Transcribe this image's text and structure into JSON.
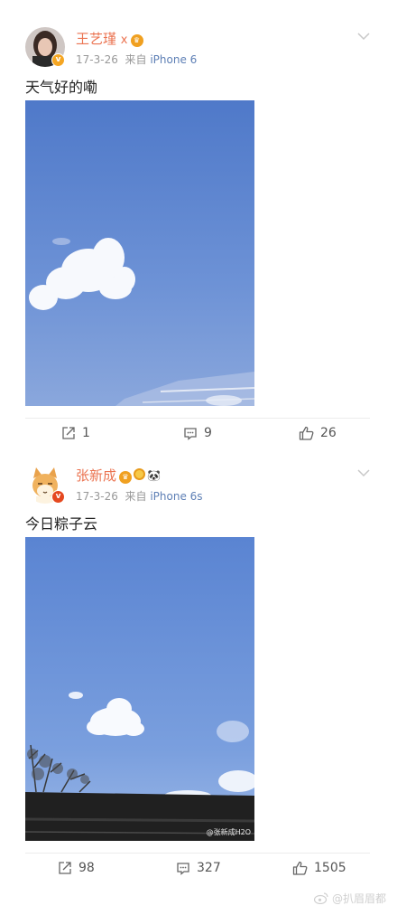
{
  "posts": [
    {
      "username": "王艺瑾",
      "user_suffix": "x",
      "date": "17-3-26",
      "source_prefix": "来自",
      "device": "iPhone 6",
      "text": "天气好的嘞",
      "actions": {
        "repost": "1",
        "comment": "9",
        "like": "26"
      }
    },
    {
      "username": "张新成",
      "date": "17-3-26",
      "source_prefix": "来自",
      "device": "iPhone 6s",
      "text": "今日粽子云",
      "photo_watermark": "@张新成H2O",
      "actions": {
        "repost": "98",
        "comment": "327",
        "like": "1505"
      }
    }
  ],
  "watermark": "@扒眉眉都",
  "colors": {
    "username": "#eb7350",
    "device": "#5d7fb5",
    "sky": "#5f86cf",
    "badge": "#f5a623"
  },
  "icons": [
    "chevron-down-icon",
    "repost-icon",
    "comment-icon",
    "like-icon",
    "verified-badge-icon",
    "weibo-logo-icon"
  ]
}
